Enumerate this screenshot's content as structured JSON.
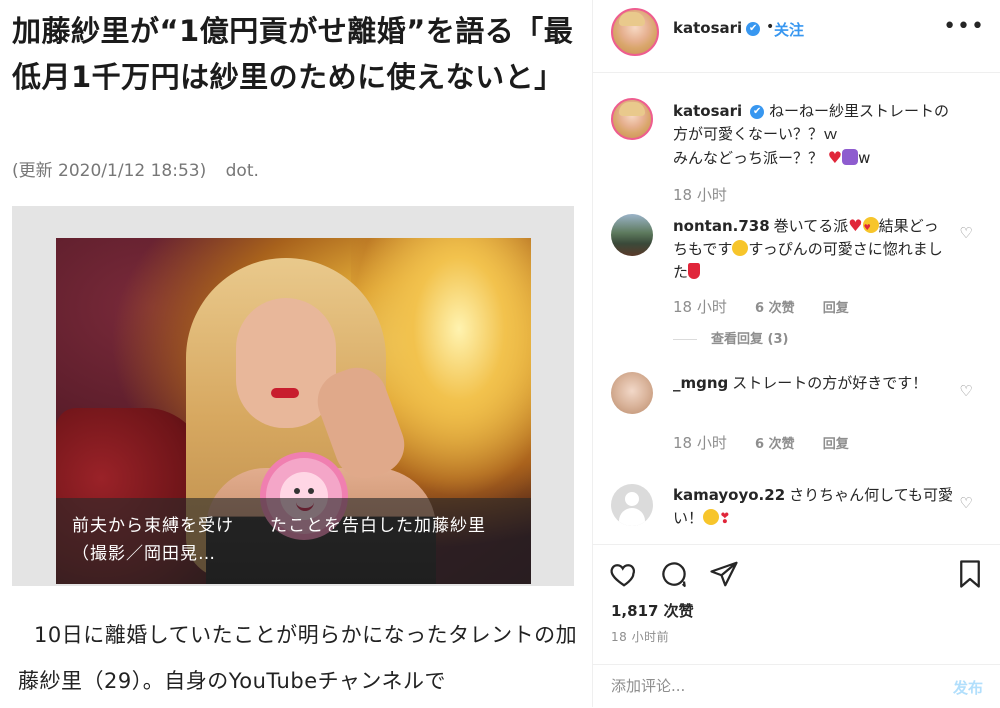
{
  "article": {
    "title": "加藤紗里が“1億円貢がせ離婚”を語る「最低月1千万円は紗里のために使えないと」",
    "updated": "(更新 2020/1/12 18:53)",
    "source": "dot.",
    "caption": "前夫から束縛を受け　　たことを告白した加藤紗里（撮影／岡田晃…",
    "body": "10日に離婚していたことが明らかになったタレントの加藤紗里（29）。自身のYouTubeチャンネルで"
  },
  "ig": {
    "header": {
      "username": "katosari",
      "verified_icon": "✔",
      "dot": "•",
      "follow_label": "关注",
      "more_icon": "•••"
    },
    "caption": {
      "username": "katosari",
      "text1": "ねーねー紗里ストレートの方が可愛くなーい？？ｗ",
      "text2": "みんなどっち派ー？？",
      "text3": "w",
      "time": "18 小时"
    },
    "comments": [
      {
        "username": "nontan.738",
        "text1": "巻いてる派",
        "text2": "結果どっちもです",
        "text3": "すっぴんの可愛さに惚れました",
        "time": "18 小时",
        "likes": "6 次赞",
        "reply_label": "回复",
        "view_replies": "查看回复 (3)"
      },
      {
        "username": "_mgng",
        "text": "ストレートの方が好きです！",
        "time": "18 小时",
        "likes": "6 次赞",
        "reply_label": "回复"
      },
      {
        "username": "kamayoyo.22",
        "text": "さりちゃん何しても可愛い！",
        "time": "",
        "likes": "",
        "reply_label": ""
      }
    ],
    "like_count": "1,817 次赞",
    "post_time": "18 小时前",
    "add_comment_placeholder": "添加评论...",
    "post_label": "发布"
  },
  "colors": {
    "link_blue": "#3897f0",
    "post_disabled": "#b2dffc",
    "meta_gray": "#8e8e8e",
    "heart_red": "#e0263a"
  }
}
